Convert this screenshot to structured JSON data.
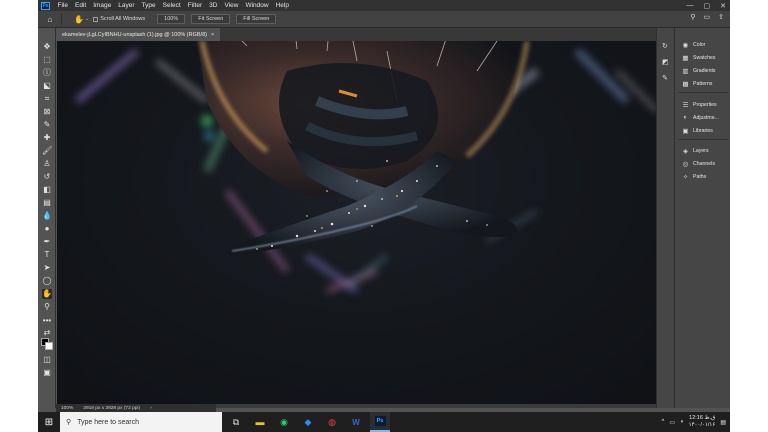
{
  "app": {
    "logo": "Ps"
  },
  "menubar": {
    "items": [
      "File",
      "Edit",
      "Image",
      "Layer",
      "Type",
      "Select",
      "Filter",
      "3D",
      "View",
      "Window",
      "Help"
    ],
    "controls": [
      "—",
      "▢",
      "✕"
    ]
  },
  "options": {
    "scroll_all_windows": "Scroll All Windows",
    "btn_100": "100%",
    "btn_fit": "Fit Screen",
    "btn_fill": "Fill Screen"
  },
  "document": {
    "tab_title": "ekamelev-jLgLCyIBNHU-unsplash (1).jpg @ 100% (RGB/8)",
    "tab_close": "×"
  },
  "status": {
    "zoom": "100%",
    "doc_info": "3918 px x 3928 px (72 ppi)",
    "arrow": "›"
  },
  "panels": {
    "group1": [
      "Color",
      "Swatches",
      "Gradients",
      "Patterns"
    ],
    "group2": [
      "Properties",
      "Adjustme...",
      "Libraries"
    ],
    "group3": [
      "Layers",
      "Channels",
      "Paths"
    ]
  },
  "taskbar": {
    "search_placeholder": "Type here to search",
    "time": "12:16 ق.ظ",
    "date": "۱۴۰۰/۰۱/۱۶"
  },
  "colors": {
    "accent_blue": "#31a8ff",
    "ps_dark": "#001e36"
  }
}
